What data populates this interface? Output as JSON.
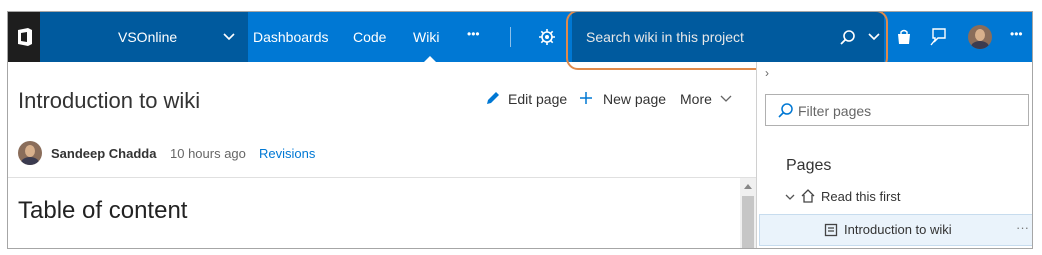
{
  "topnav": {
    "account": "VSOnline",
    "items": [
      "Dashboards",
      "Code",
      "Wiki"
    ],
    "more": "•••",
    "search_placeholder": "Search wiki in this project",
    "overflow": "•••"
  },
  "page": {
    "title": "Introduction to wiki",
    "edit": "Edit page",
    "new": "New page",
    "more": "More",
    "author": "Sandeep Chadda",
    "time": "10 hours ago",
    "revisions": "Revisions",
    "toc": "Table of content"
  },
  "sidepane": {
    "collapse": "›",
    "filter_placeholder": "Filter pages",
    "heading": "Pages",
    "tree": {
      "parent": "Read this first",
      "child": "Introduction to wiki",
      "child_more": "···"
    }
  },
  "colors": {
    "nav": "#0078d4",
    "nav_dark": "#005a9e",
    "logo_bg": "#1e1e1e",
    "highlight": "#e08a4b",
    "link": "#0078d4"
  }
}
